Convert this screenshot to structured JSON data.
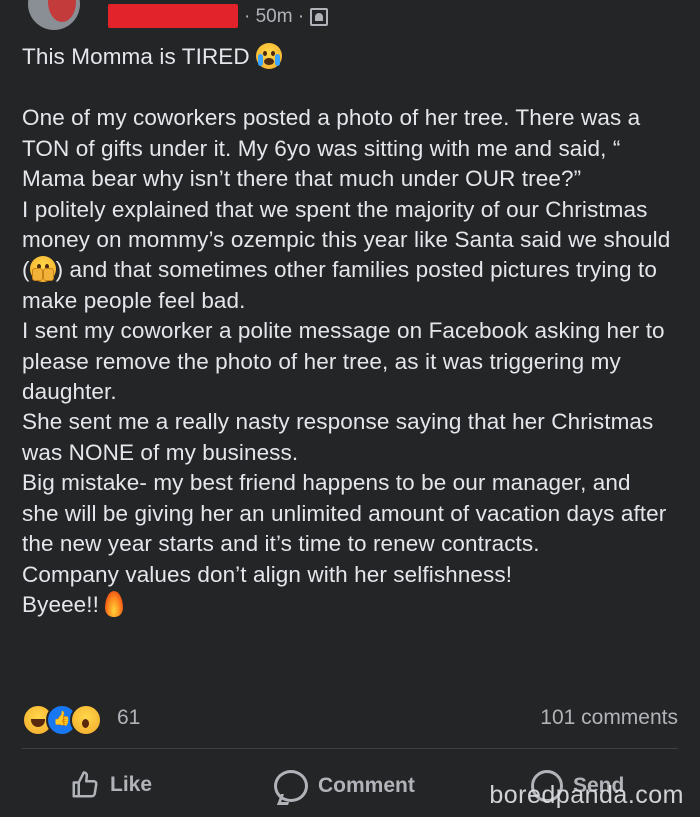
{
  "post": {
    "meta_time": "· 50m ·",
    "title": "This Momma is TIRED",
    "body_parts": {
      "p1": "One of my coworkers posted a photo of her tree. There was a TON of gifts under it. My 6yo was sitting with me and said, “ Mama bear why isn’t there that much under OUR tree?”\nI politely explained that we spent the majority of our Christmas money on mommy’s ozempic this year like Santa said we should (",
      "p2": ") and that sometimes other families posted pictures trying to make people feel bad.\nI sent my coworker a polite message on Facebook asking her to please remove the photo of her tree, as it was triggering my daughter.\nShe sent me a really nasty response saying that her Christmas was NONE of my business.\nBig mistake- my best friend happens to be our manager, and she will be giving her an unlimited amount of vacation days after the new year starts and it’s time to renew contracts.\nCompany values don’t align with her selfishness!\nByeee!! "
    }
  },
  "engagement": {
    "reaction_count": "61",
    "comments": "101 comments"
  },
  "actions": {
    "like": "Like",
    "comment": "Comment",
    "send": "Send"
  },
  "watermark": "boredpanda.com",
  "icons": {
    "title_emoji": "crying-face-icon",
    "inline_emoji": "fearful-face-icon",
    "end_emoji": "fire-icon",
    "privacy": "friends-privacy-icon"
  },
  "colors": {
    "background": "#242526",
    "text": "#e4e6eb",
    "muted": "#b0b3b8",
    "redaction": "#e2232b"
  }
}
